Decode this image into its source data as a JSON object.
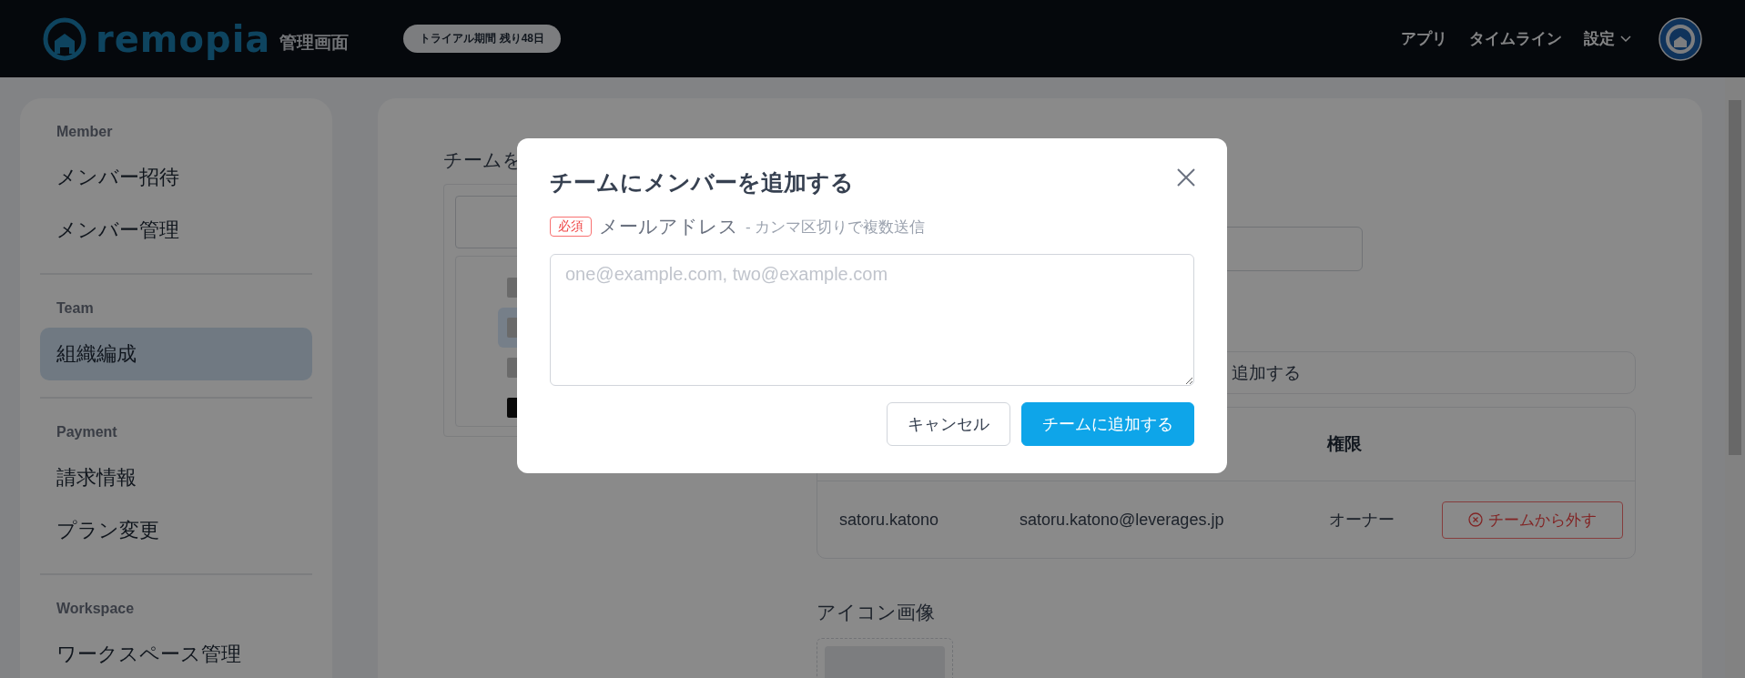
{
  "header": {
    "brand": "remopia",
    "brand_sub": "管理画面",
    "trial_badge": "トライアル期間 残り48日",
    "nav": [
      {
        "label": "アプリ",
        "kind": "link"
      },
      {
        "label": "タイムライン",
        "kind": "link"
      },
      {
        "label": "設定",
        "kind": "dropdown"
      }
    ]
  },
  "sidebar": {
    "sections": [
      {
        "title": "Member",
        "items": [
          {
            "label": "メンバー招待",
            "selected": false
          },
          {
            "label": "メンバー管理",
            "selected": false
          }
        ]
      },
      {
        "title": "Team",
        "items": [
          {
            "label": "組織編成",
            "selected": true
          }
        ]
      },
      {
        "title": "Payment",
        "items": [
          {
            "label": "請求情報",
            "selected": false
          },
          {
            "label": "プラン変更",
            "selected": false
          }
        ]
      },
      {
        "title": "Workspace",
        "items": [
          {
            "label": "ワークスペース管理",
            "selected": false
          }
        ]
      }
    ]
  },
  "main": {
    "tree_label": "チームを",
    "tree_items": [
      {
        "kind": "square",
        "selected": false
      },
      {
        "kind": "square",
        "selected": true
      },
      {
        "kind": "square",
        "selected": false
      },
      {
        "kind": "avatar",
        "selected": false
      }
    ],
    "add_bar": "追加する",
    "table": {
      "columns": [
        "権限"
      ],
      "rows": [
        {
          "name": "satoru.katono",
          "email": "satoru.katono@leverages.jp",
          "role": "オーナー",
          "action": "チームから外す"
        }
      ]
    },
    "icon_label": "アイコン画像"
  },
  "modal": {
    "title": "チームにメンバーを追加する",
    "required_badge": "必須",
    "field_label": "メールアドレス",
    "field_hint": "- カンマ区切りで複数送信",
    "placeholder": "one@example.com, two@example.com",
    "buttons": [
      {
        "label": "キャンセル",
        "kind": "secondary"
      },
      {
        "label": "チームに追加する",
        "kind": "primary"
      }
    ]
  }
}
